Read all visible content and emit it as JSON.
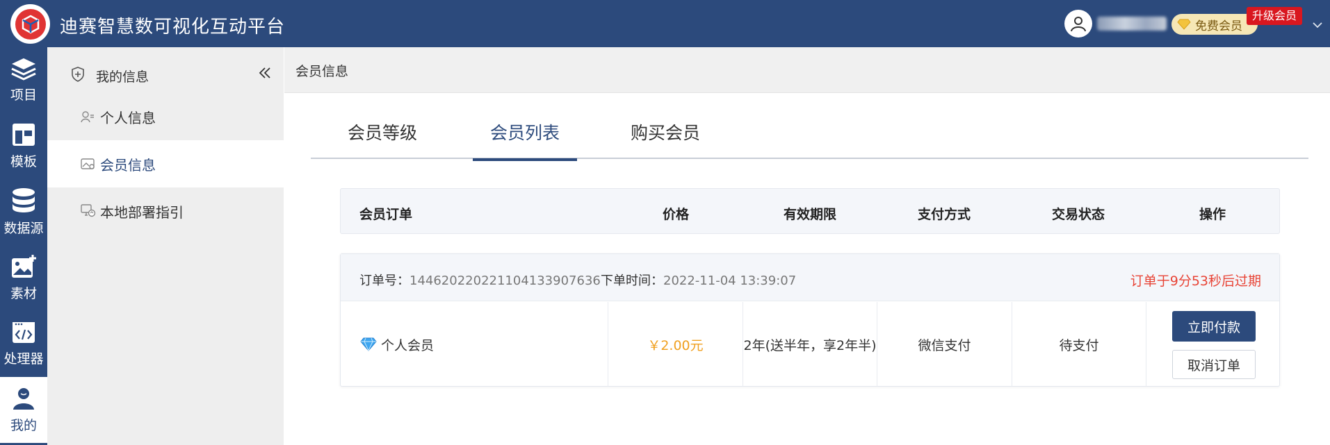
{
  "header": {
    "app_title": "迪赛智慧数可视化互动平台",
    "free_member_label": "免费会员",
    "upgrade_label": "升级会员",
    "brand_color": "#2c4a7c"
  },
  "nav": {
    "items": [
      {
        "label": "项目",
        "icon": "layers-icon"
      },
      {
        "label": "模板",
        "icon": "template-icon"
      },
      {
        "label": "数据源",
        "icon": "database-icon"
      },
      {
        "label": "素材",
        "icon": "image-add-icon"
      },
      {
        "label": "处理器",
        "icon": "code-icon"
      },
      {
        "label": "我的",
        "icon": "user-icon"
      }
    ],
    "active": "我的"
  },
  "subnav": {
    "title": "我的信息",
    "items": [
      {
        "label": "个人信息",
        "icon": "user-card-icon"
      },
      {
        "label": "会员信息",
        "icon": "member-card-icon"
      },
      {
        "label": "本地部署指引",
        "icon": "deploy-icon"
      }
    ],
    "active": "会员信息"
  },
  "breadcrumb": "会员信息",
  "tabs": [
    {
      "label": "会员等级"
    },
    {
      "label": "会员列表"
    },
    {
      "label": "购买会员"
    }
  ],
  "active_tab": "会员列表",
  "table": {
    "headers": [
      "会员订单",
      "价格",
      "有效期限",
      "支付方式",
      "交易状态",
      "操作"
    ]
  },
  "order": {
    "order_no_label": "订单号：",
    "order_no": "144620220221104133907636",
    "order_time_label": "下单时间：",
    "order_time": "2022-11-04 13:39:07",
    "expire_notice": "订单于9分53秒后过期",
    "product": "个人会员",
    "price": "￥2.00元",
    "validity": "2年(送半年，享2年半)",
    "payment": "微信支付",
    "status": "待支付",
    "pay_button": "立即付款",
    "cancel_button": "取消订单"
  }
}
